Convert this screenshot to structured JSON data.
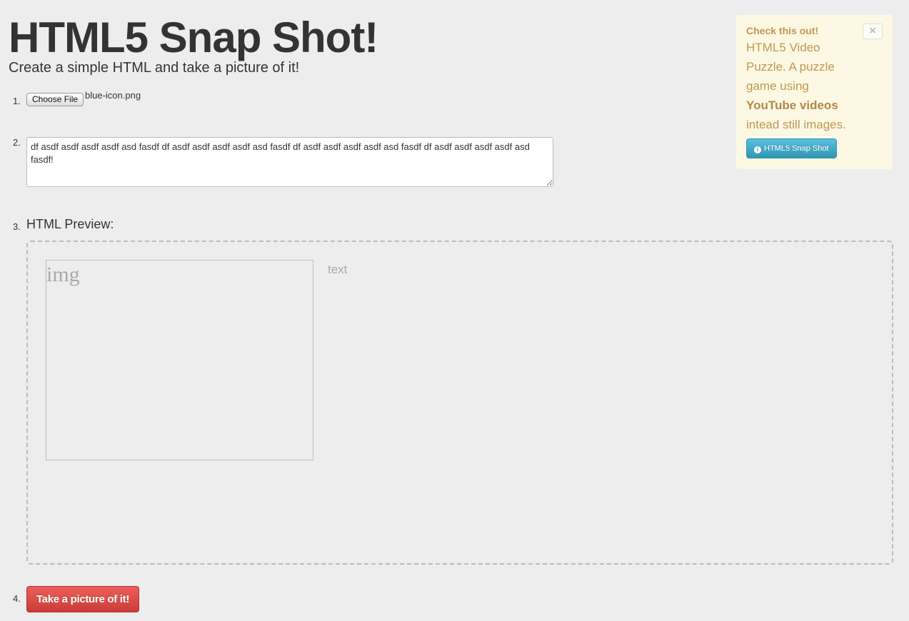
{
  "header": {
    "title": "HTML5 Snap Shot!",
    "subtitle": "Create a simple HTML and take a picture of it!"
  },
  "steps": {
    "step1_num": "1.",
    "step2_num": "2.",
    "step3_num": "3.",
    "step4_num": "4."
  },
  "file_input": {
    "button_label": "Choose File",
    "file_name": "blue-icon.png"
  },
  "text_input": {
    "value": "df asdf asdf asdf asdf asd fasdf df asdf asdf asdf asdf asd fasdf df asdf asdf asdf asdf asd fasdf df asdf asdf asdf asdf asd fasdf!"
  },
  "preview": {
    "label": "HTML Preview:",
    "img_placeholder": "img",
    "text_placeholder": "text"
  },
  "actions": {
    "take_picture_label": "Take a picture of it!"
  },
  "alert": {
    "heading": "Check this out!",
    "body_before": "HTML5 Video Puzzle. A puzzle game using ",
    "body_bold": "YouTube videos",
    "body_after": " intead still images.",
    "close_glyph": "×",
    "button_label": "HTML5 Snap Shot",
    "button_icon": "info-icon"
  },
  "colors": {
    "background": "#ededed",
    "danger": "#da4f49",
    "info": "#49afcd",
    "alert_bg": "#fcf8e3",
    "alert_text": "#c09853"
  }
}
